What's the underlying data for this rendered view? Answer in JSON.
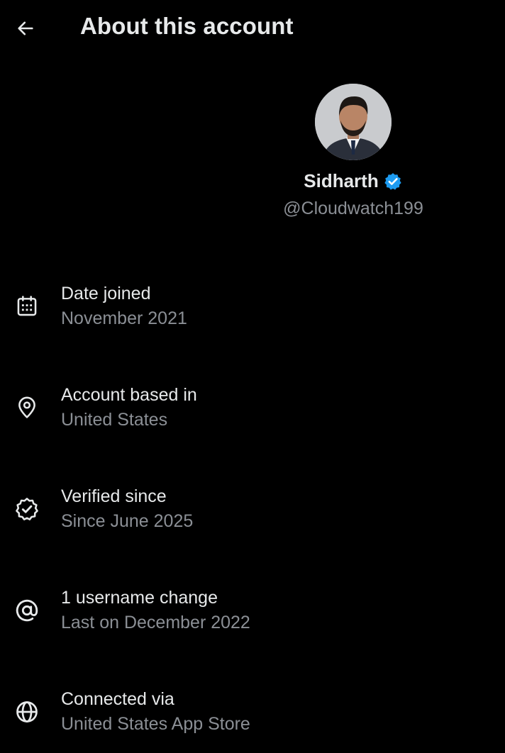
{
  "header": {
    "title": "About this account",
    "back_icon": "arrow-left-icon"
  },
  "profile": {
    "display_name": "Sidharth",
    "handle": "@Cloudwatch199",
    "verified": true,
    "badge_color": "#1d9bf0"
  },
  "info_items": [
    {
      "icon": "calendar-icon",
      "label": "Date joined",
      "value": "November 2021"
    },
    {
      "icon": "location-pin-icon",
      "label": "Account based in",
      "value": "United States"
    },
    {
      "icon": "verified-check-icon",
      "label": "Verified since",
      "value": "Since June 2025"
    },
    {
      "icon": "at-sign-icon",
      "label": "1 username change",
      "value": "Last on December 2022"
    },
    {
      "icon": "globe-icon",
      "label": "Connected via",
      "value": "United States App Store"
    }
  ],
  "colors": {
    "background": "#000000",
    "primary_text": "#e7e9ea",
    "secondary_text": "#8b8f95",
    "accent": "#1d9bf0"
  }
}
